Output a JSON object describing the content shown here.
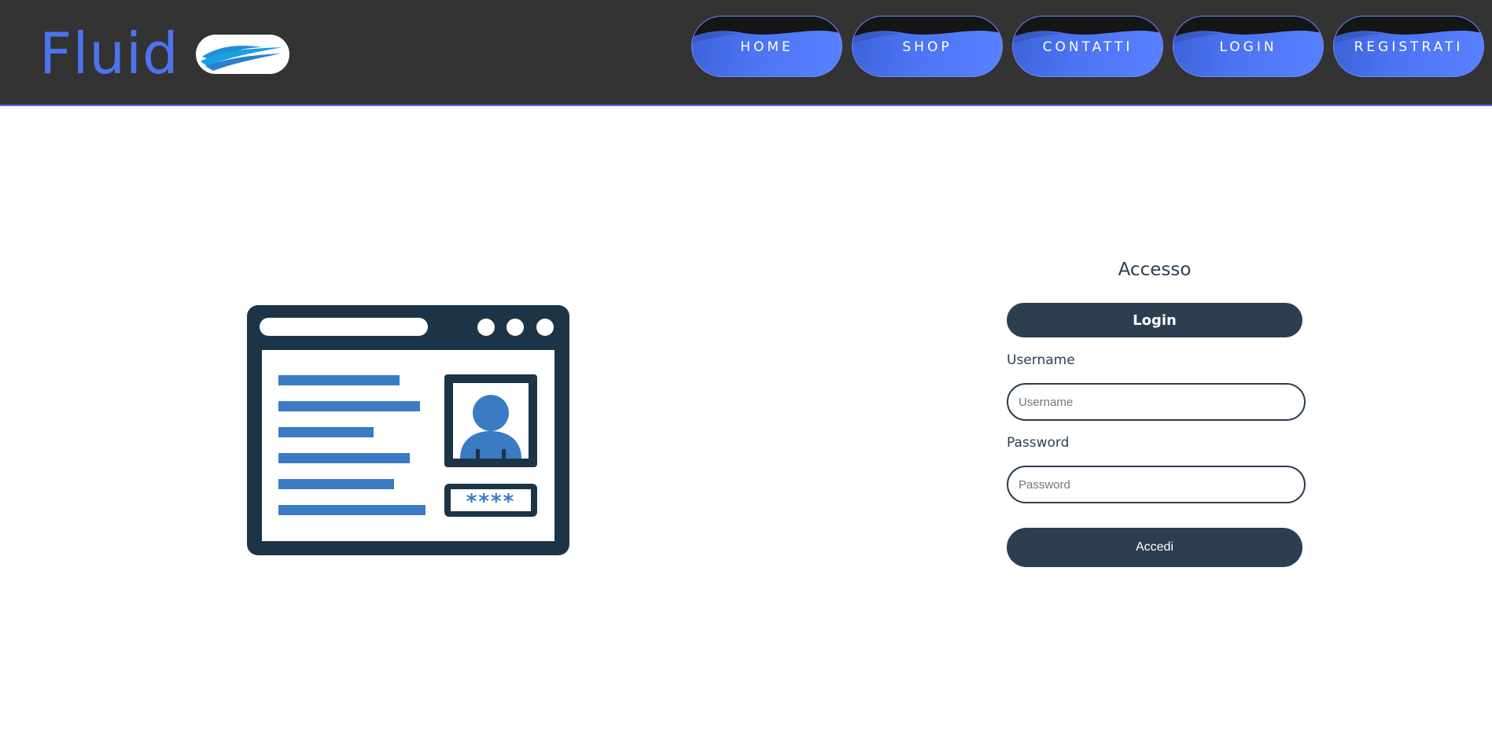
{
  "header": {
    "brand": "Fluid",
    "logo_icon": "wave-logo-icon",
    "nav": [
      {
        "label": "HOME"
      },
      {
        "label": "SHOP"
      },
      {
        "label": "CONTATTI"
      },
      {
        "label": "LOGIN"
      },
      {
        "label": "REGISTRATI"
      }
    ]
  },
  "illustration": {
    "icon": "id-card-browser-icon",
    "password_mask": "****"
  },
  "login_form": {
    "title": "Accesso",
    "tab_label": "Login",
    "username_label": "Username",
    "username_placeholder": "Username",
    "username_value": "",
    "password_label": "Password",
    "password_placeholder": "Password",
    "password_value": "",
    "submit_label": "Accedi"
  },
  "colors": {
    "header_bg": "#333333",
    "accent": "#4d74ee",
    "dark": "#2d3e50",
    "illustration_dark": "#1c3446",
    "illustration_blue": "#3a7bc4"
  }
}
